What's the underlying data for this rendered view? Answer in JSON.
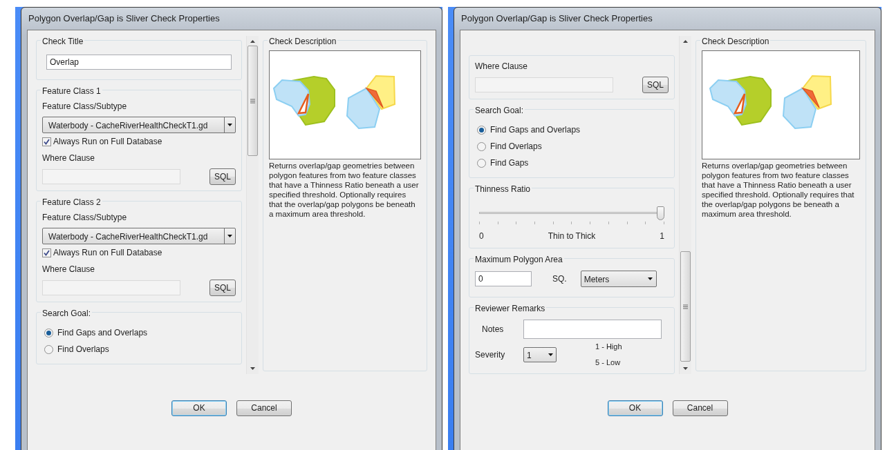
{
  "dialogs": [
    {
      "title": "Polygon Overlap/Gap is Sliver Check Properties",
      "scrolled": false,
      "sections": [
        {
          "kind": "text",
          "legend": "Check Title",
          "value": "Overlap"
        },
        {
          "kind": "feature_class",
          "legend": "Feature Class 1",
          "subtype_label": "Feature Class/Subtype",
          "dropdown": "Waterbody -  CacheRiverHealthCheckT1.gd",
          "always_run": {
            "label": "Always Run on Full Database",
            "checked": true
          },
          "where_label": "Where Clause",
          "sql": "SQL"
        },
        {
          "kind": "feature_class",
          "legend": "Feature Class 2",
          "subtype_label": "Feature Class/Subtype",
          "dropdown": "Waterbody -  CacheRiverHealthCheckT1.gd",
          "always_run": {
            "label": "Always Run on Full Database",
            "checked": true
          },
          "where_label": "Where Clause",
          "sql": "SQL"
        },
        {
          "kind": "radio",
          "legend": "Search Goal:",
          "options": [
            {
              "label": "Find Gaps and Overlaps",
              "selected": true
            },
            {
              "label": "Find Overlaps",
              "selected": false
            }
          ]
        }
      ],
      "description": {
        "legend": "Check Description",
        "text": "Returns overlap/gap geometries between polygon features from two feature classes that have a Thinness Ratio beneath a user specified threshold. Optionally requires that the overlap/gap polygons be beneath a maximum area threshold."
      },
      "buttons": [
        {
          "label": "OK",
          "default": true
        },
        {
          "label": "Cancel",
          "default": false
        }
      ]
    },
    {
      "title": "Polygon Overlap/Gap is Sliver Check Properties",
      "scrolled": true,
      "sections": [
        {
          "kind": "where",
          "where_label": "Where Clause",
          "sql": "SQL"
        },
        {
          "kind": "radio",
          "legend": "Search Goal:",
          "options": [
            {
              "label": "Find Gaps and Overlaps",
              "selected": true
            },
            {
              "label": "Find Overlaps",
              "selected": false
            },
            {
              "label": "Find Gaps",
              "selected": false
            }
          ]
        },
        {
          "kind": "slider",
          "legend": "Thinness Ratio",
          "level": 1,
          "min_label": "0",
          "caption": "Thin to Thick",
          "max_label": "1"
        },
        {
          "kind": "area",
          "legend": "Maximum Polygon Area",
          "value": "0",
          "unit_label": "SQ.",
          "unit": "Meters"
        },
        {
          "kind": "remarks",
          "legend": "Reviewer Remarks",
          "notes_label": "Notes",
          "severity_label": "Severity",
          "severity": "1",
          "scale": [
            "1 - High",
            "5 - Low"
          ]
        }
      ],
      "description": {
        "legend": "Check Description",
        "text": "Returns overlap/gap geometries between polygon features from two feature classes that have a Thinness Ratio beneath a user specified threshold. Optionally requires that the overlap/gap polygons be beneath a maximum area threshold."
      },
      "buttons": [
        {
          "label": "OK",
          "default": true
        },
        {
          "label": "Cancel",
          "default": false
        }
      ]
    }
  ]
}
